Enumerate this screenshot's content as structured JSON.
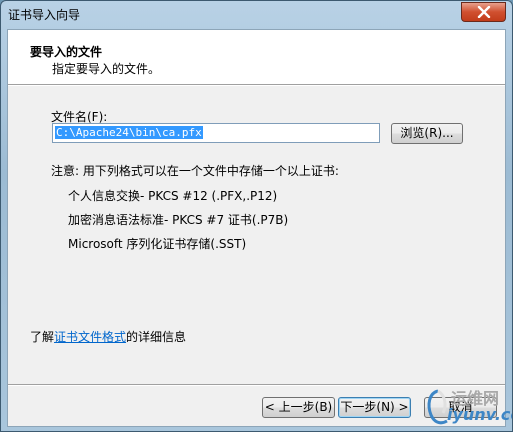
{
  "window": {
    "title": "证书导入向导"
  },
  "header": {
    "title": "要导入的文件",
    "subtitle": "指定要导入的文件。"
  },
  "form": {
    "file_label": "文件名(F):",
    "file_value": "C:\\Apache24\\bin\\ca.pfx",
    "browse_label": "浏览(R)..."
  },
  "note": {
    "text": "注意: 用下列格式可以在一个文件中存储一个以上证书:",
    "formats": [
      "个人信息交换- PKCS #12 (.PFX,.P12)",
      "加密消息语法标准- PKCS #7 证书(.P7B)",
      "Microsoft 序列化证书存储(.SST)"
    ]
  },
  "more_info": {
    "prefix": "了解",
    "link": "证书文件格式",
    "suffix": "的详细信息"
  },
  "buttons": {
    "back": "< 上一步(B)",
    "next": "下一步(N) >",
    "cancel": "取消"
  },
  "watermark": {
    "top": "运维网",
    "bottom": "iyunv.com"
  },
  "colors": {
    "selection": "#3399ff",
    "link": "#0066cc",
    "close": "#c23d1b"
  }
}
